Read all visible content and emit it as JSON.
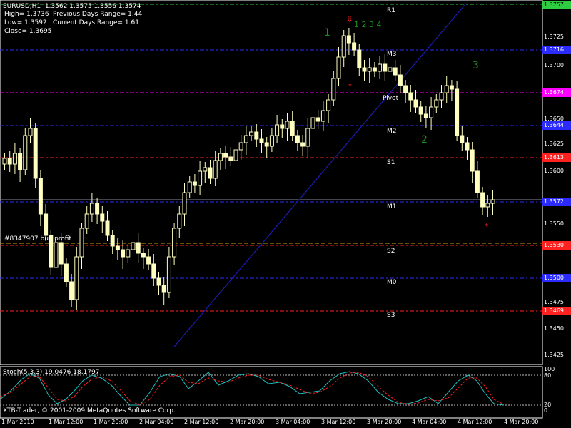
{
  "info": {
    "title": "EURUSD,H1  1.3562 1.3575 1.3556 1.3574",
    "high": "High= 1.3736",
    "low": "Low= 1.3592",
    "close": "Close= 1.3695",
    "prev_range": "Previous Days Range= 1.44",
    "curr_range": "Current Days Range= 1.61"
  },
  "levels": [
    {
      "label": "R1",
      "price": "1.3757",
      "tag_color": "#2ecc40",
      "line_color": "#2ecc40"
    },
    {
      "label": "M3",
      "price": "1.3716",
      "tag_color": "#2b2bff",
      "line_color": "#2b2bff"
    },
    {
      "label": "Pivot",
      "price": "1.3674",
      "tag_color": "#ff00ff",
      "line_color": "#ff00ff"
    },
    {
      "label": "M2",
      "price": "1.3644",
      "tag_color": "#2b2bff",
      "line_color": "#2b2bff"
    },
    {
      "label": "S1",
      "price": "1.3613",
      "tag_color": "#ff2020",
      "line_color": "#ff2020"
    },
    {
      "label": "M1",
      "price": "1.3572",
      "tag_color": "#2b2bff",
      "line_color": "#2b2bff"
    },
    {
      "label": "S2",
      "price": "1.3530",
      "tag_color": "#ff2020",
      "line_color": "#ff2020"
    },
    {
      "label": "M0",
      "price": "1.3500",
      "tag_color": "#2b2bff",
      "line_color": "#2b2bff"
    },
    {
      "label": "S3",
      "price": "1.3469",
      "tag_color": "#ff2020",
      "line_color": "#ff2020"
    }
  ],
  "y_axis": [
    "1.3725",
    "1.3700",
    "1.3650",
    "1.3625",
    "1.3600",
    "1.3550",
    "1.3475",
    "1.3450",
    "1.3425"
  ],
  "x_axis": [
    "1 Mar 2010",
    "1 Mar 12:00",
    "1 Mar 20:00",
    "2 Mar 04:00",
    "2 Mar 12:00",
    "2 Mar 20:00",
    "3 Mar 04:00",
    "3 Mar 12:00",
    "3 Mar 20:00",
    "4 Mar 04:00",
    "4 Mar 12:00",
    "4 Mar 20:00"
  ],
  "order_label": "#8347907 buy profit",
  "waves": {
    "w1": "1",
    "w1_sub": "1 2 3 4",
    "w2": "2",
    "w3": "3"
  },
  "stoch": {
    "label": "Stoch(5,3,3) 19.0476 18.1797",
    "levels": [
      "100",
      "80",
      "20",
      "0"
    ]
  },
  "copyright": "XTB-Trader, © 2001-2009 MetaQuotes Software Corp.",
  "colors": {
    "background": "#000000",
    "candle": "#ffffc0",
    "trendline": "#1c1cb0",
    "stoch_main": "#20c0c0",
    "stoch_signal": "#ff2020"
  }
}
